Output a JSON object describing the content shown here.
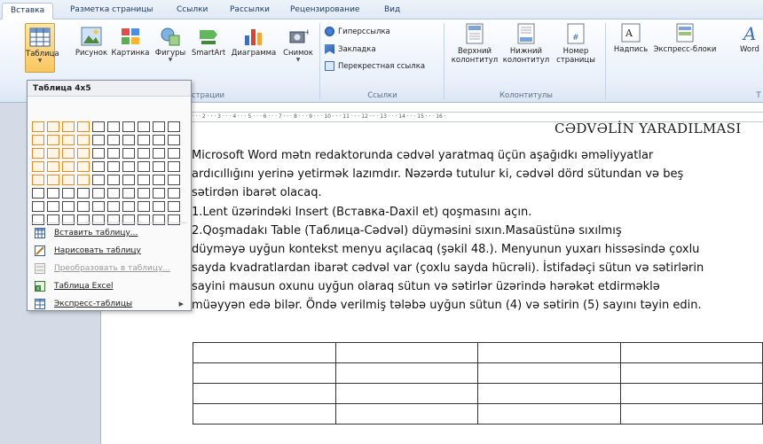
{
  "tabs": [
    "Вставка",
    "Разметка страницы",
    "Ссылки",
    "Рассылки",
    "Рецензирование",
    "Вид"
  ],
  "ribbon": {
    "buttons": {
      "table": "Таблица",
      "picture": "Рисунок",
      "clipart": "Картинка",
      "shapes": "Фигуры",
      "smartart": "SmartArt",
      "chart": "Диаграмма",
      "screenshot": "Снимок",
      "header": "Верхний колонтитул",
      "footer": "Нижний колонтитул",
      "page_number": "Номер страницы",
      "textbox": "Надпись",
      "quickparts": "Экспресс-блоки",
      "wordart": "Word"
    },
    "header_line1": "Верхний",
    "header_line2": "колонтитул",
    "footer_line1": "Нижний",
    "footer_line2": "колонтитул",
    "pagenum_line1": "Номер",
    "pagenum_line2": "страницы",
    "links": {
      "hyperlink": "Гиперссылка",
      "bookmark": "Закладка",
      "crossref": "Перекрестная ссылка"
    },
    "groups": {
      "illustrations_fragment": "страции",
      "links": "Ссылки",
      "headers_footers": "Колонтитулы",
      "text_fragment": "Т"
    }
  },
  "menu": {
    "title": "Таблица 4x5",
    "items": [
      {
        "label": "Вставить таблицу...",
        "icon": "insert-table-icon",
        "disabled": false
      },
      {
        "label": "Нарисовать таблицу",
        "icon": "draw-table-icon",
        "disabled": false
      },
      {
        "label": "Преобразовать в таблицу...",
        "icon": "convert-table-icon",
        "disabled": true
      },
      {
        "label": "Таблица Excel",
        "icon": "excel-table-icon",
        "disabled": false
      },
      {
        "label": "Экспресс-таблицы",
        "icon": "quick-tables-icon",
        "disabled": false
      }
    ],
    "grid_cols": 10,
    "grid_rows": 8,
    "selected_cols": 4,
    "selected_rows": 5
  },
  "ruler_text": "· 1 · · · 2 · · · 3 · · · 4 · · · 5 · · · 6 · · · 7 · · · 8 · · · 9 · · · 10 · · · 11 · · · 12 · · · 13 · · · 14 · · · 15 · · · 16 ·",
  "document": {
    "heading": "CƏDVƏLİN YARADILMASI",
    "lines": [
      "       Microsoft Word mətn redaktorunda cədvəl yaratmaq üçün aşağıdkı əməliyyatlar",
      "ardıcıllığını yerinə yetirmək lazımdır. Nəzərdə tutulur ki, cədvəl dörd sütundan və beş",
      "sətirdən ibarət olacaq.",
      "       1.Lent üzərindəki  Insert (Вставка-Daxil et) qoşmasını açın.",
      "       2.Qoşmadakı Table (Таблица-Cədvəl) düyməsini sıxın.Masaüstünə sıxılmış",
      "düyməyə uyğun kontekst menyu açılacaq (şəkil 48.). Menyunun yuxarı hissəsində çoxlu",
      "sayda kvadratlardan ibarət cədvəl var (çoxlu sayda hücrəli). İstifadəçi sütun və sətirlərin",
      "sayini mausun oxunu uyğun olaraq sütun və sətirlər üzərində hərəkət etdirməklə",
      "müəyyən edə bilər. Öndə verilmiş tələbə uyğun sütun (4) və sətirin (5) sayını təyin edin."
    ]
  },
  "colors": {
    "grid_highlight": "#f08a1e",
    "ribbon_bg": "#e9f0fa",
    "accent": "#2b579a"
  }
}
